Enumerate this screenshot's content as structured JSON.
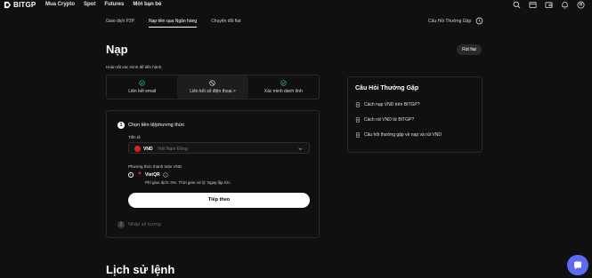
{
  "brand": {
    "name": "BITGP"
  },
  "nav": {
    "items": [
      "Mua Crypto",
      "Spot",
      "Futures",
      "Mời bạn bè"
    ],
    "icons": [
      "search-icon",
      "download-icon",
      "wallet-icon",
      "bell-icon",
      "user-icon"
    ]
  },
  "subtabs": [
    "Giao dịch P2P",
    "Nạp tiền qua Ngân hàng",
    "Chuyển đổi fiat"
  ],
  "faq_link": "Câu Hỏi Thường Gặp",
  "page": {
    "title": "Nạp",
    "badge_button": "Rút fiat",
    "hint": "Hoàn tất xác minh để tiến hành."
  },
  "verify_steps": [
    {
      "label": "Liên kết email",
      "status": "done"
    },
    {
      "label": "Liên kết số điện thoại >",
      "status": "pending"
    },
    {
      "label": "Xác minh danh tính",
      "status": "done"
    }
  ],
  "form": {
    "step1": {
      "num": "1",
      "title": "Chọn tiền tệ/phương thức"
    },
    "currency_label": "Tiền tệ",
    "currency": {
      "code": "VND",
      "name": "Việt Nam Đồng"
    },
    "method_label": "Phương thức thanh toán VND",
    "method": {
      "name": "VietQR",
      "fee": "Phí giao dịch: 0%. Thời gian xử lý: Ngay lập tức."
    },
    "continue_label": "Tiếp theo",
    "step2": {
      "num": "2",
      "title": "Nhập số lượng"
    }
  },
  "faq": {
    "title": "Câu Hỏi Thường Gặp",
    "items": [
      "Cách nạp VND trên BITGP?",
      "Cách rút VND từ BITGP?",
      "Câu hỏi thường gặp về nạp và rút VND"
    ]
  },
  "history_title": "Lịch sử lệnh",
  "colors": {
    "background": "#101010",
    "accent_green": "#2ebd85",
    "flag_red": "#da251d",
    "chat": "#5c6cf2"
  }
}
